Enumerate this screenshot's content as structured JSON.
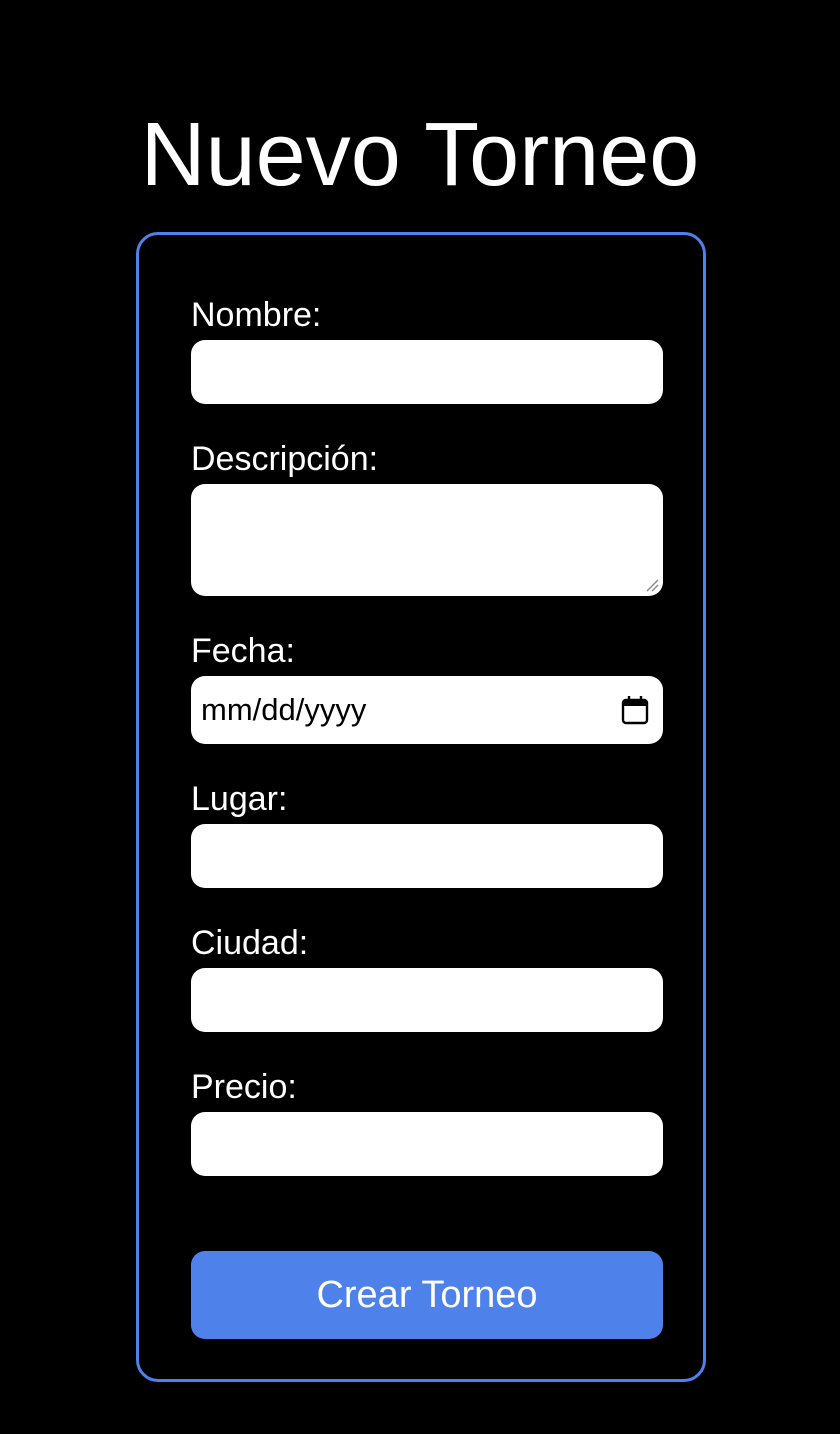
{
  "page": {
    "title": "Nuevo Torneo"
  },
  "form": {
    "nombre": {
      "label": "Nombre:",
      "value": ""
    },
    "descripcion": {
      "label": "Descripción:",
      "value": ""
    },
    "fecha": {
      "label": "Fecha:",
      "placeholder": "mm/dd/yyyy",
      "icon": "calendar-icon"
    },
    "lugar": {
      "label": "Lugar:",
      "value": ""
    },
    "ciudad": {
      "label": "Ciudad:",
      "value": ""
    },
    "precio": {
      "label": "Precio:",
      "value": ""
    },
    "submit_label": "Crear Torneo"
  },
  "colors": {
    "background": "#000000",
    "accent": "#4e82ea",
    "input_background": "#ffffff",
    "text": "#ffffff"
  }
}
